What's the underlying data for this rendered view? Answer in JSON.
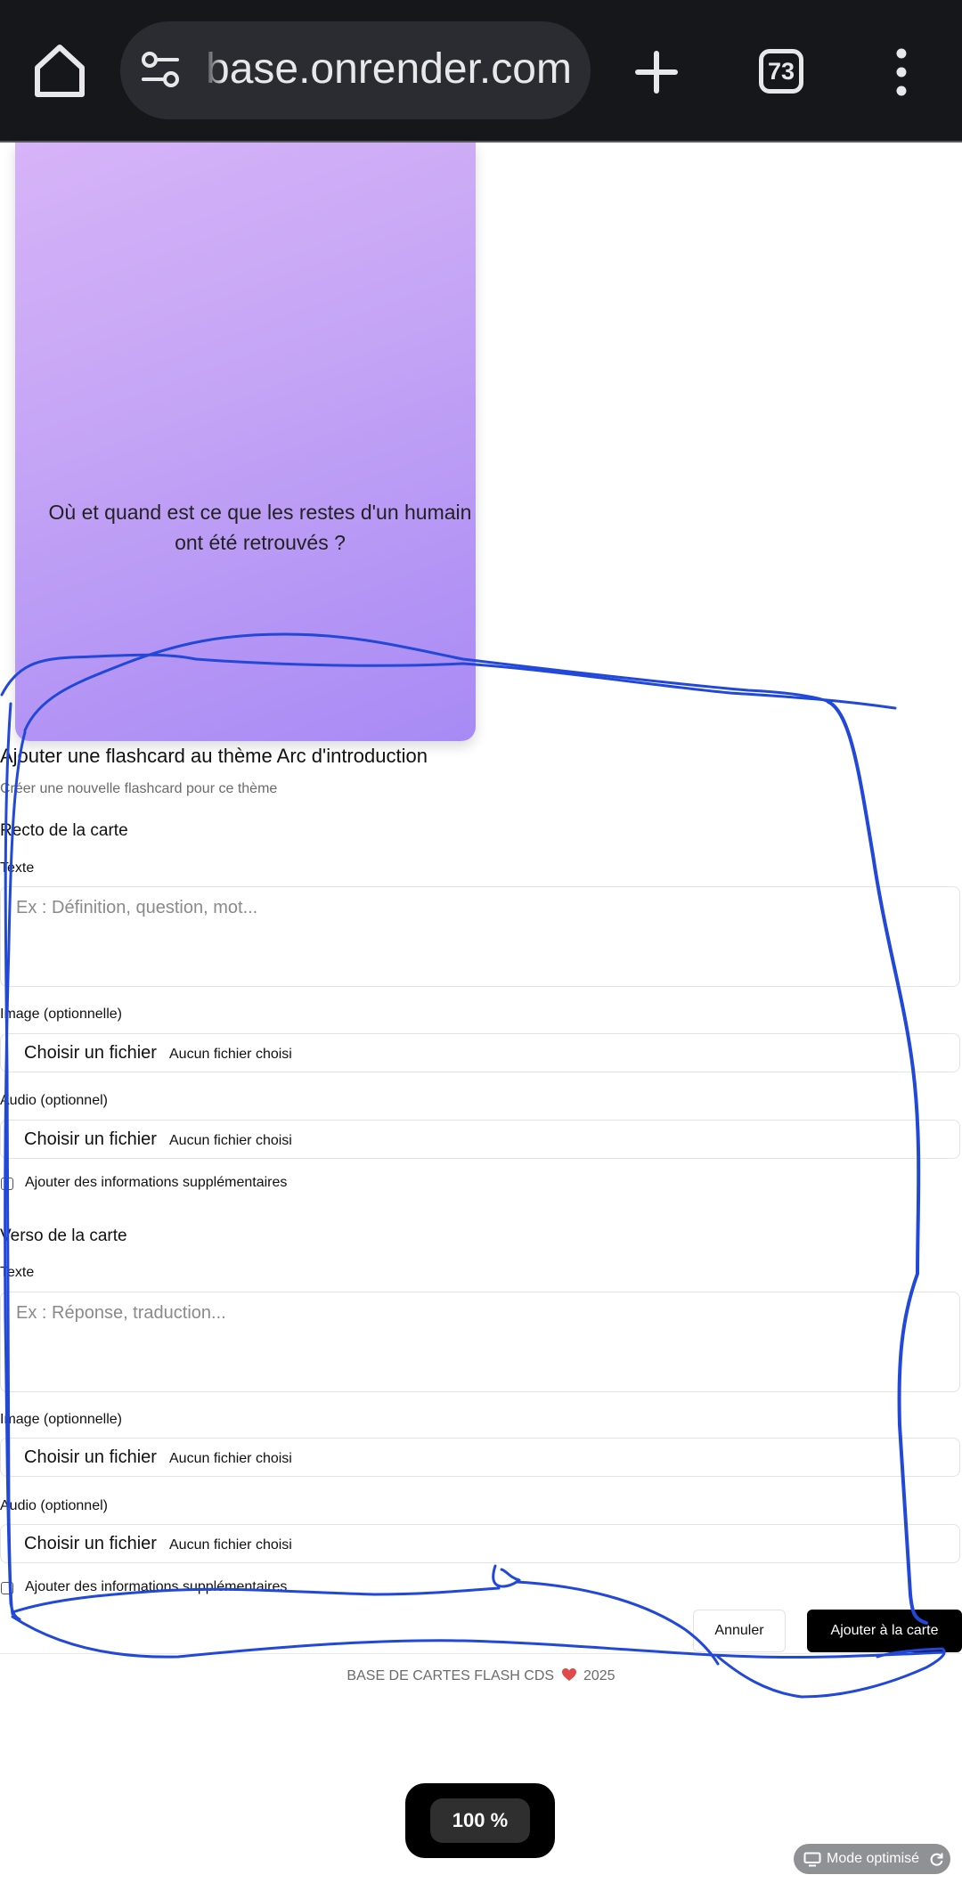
{
  "browser": {
    "url": "base.onrender.com",
    "tab_count": "73"
  },
  "card": {
    "question": "Où et quand est ce que les restes d'un humain ont été retrouvés ?"
  },
  "form": {
    "title": "Ajouter une flashcard au thème Arc d'introduction",
    "subtitle": "Créer une nouvelle flashcard pour ce thème",
    "front": {
      "heading": "Recto de la carte",
      "text_label": "Texte",
      "text_placeholder": "Ex : Définition, question, mot...",
      "image_label": "Image (optionnelle)",
      "audio_label": "Audio (optionnel)",
      "choose_file": "Choisir un fichier",
      "no_file": "Aucun fichier choisi",
      "extra_label": "Ajouter des informations supplémentaires"
    },
    "back": {
      "heading": "Verso de la carte",
      "text_label": "Texte",
      "text_placeholder": "Ex : Réponse, traduction...",
      "image_label": "Image (optionnelle)",
      "audio_label": "Audio (optionnel)",
      "choose_file": "Choisir un fichier",
      "no_file": "Aucun fichier choisi",
      "extra_label": "Ajouter des informations supplémentaires"
    },
    "cancel_label": "Annuler",
    "submit_label": "Ajouter à la carte"
  },
  "footer": {
    "brand": "BASE DE CARTES FLASH CDS",
    "year": "2025"
  },
  "zoom": {
    "level": "100 %"
  },
  "mode": {
    "label": "Mode optimisé"
  },
  "colors": {
    "accent": "#000000",
    "scribble": "#2148d8",
    "heart": "#e04a4a"
  }
}
